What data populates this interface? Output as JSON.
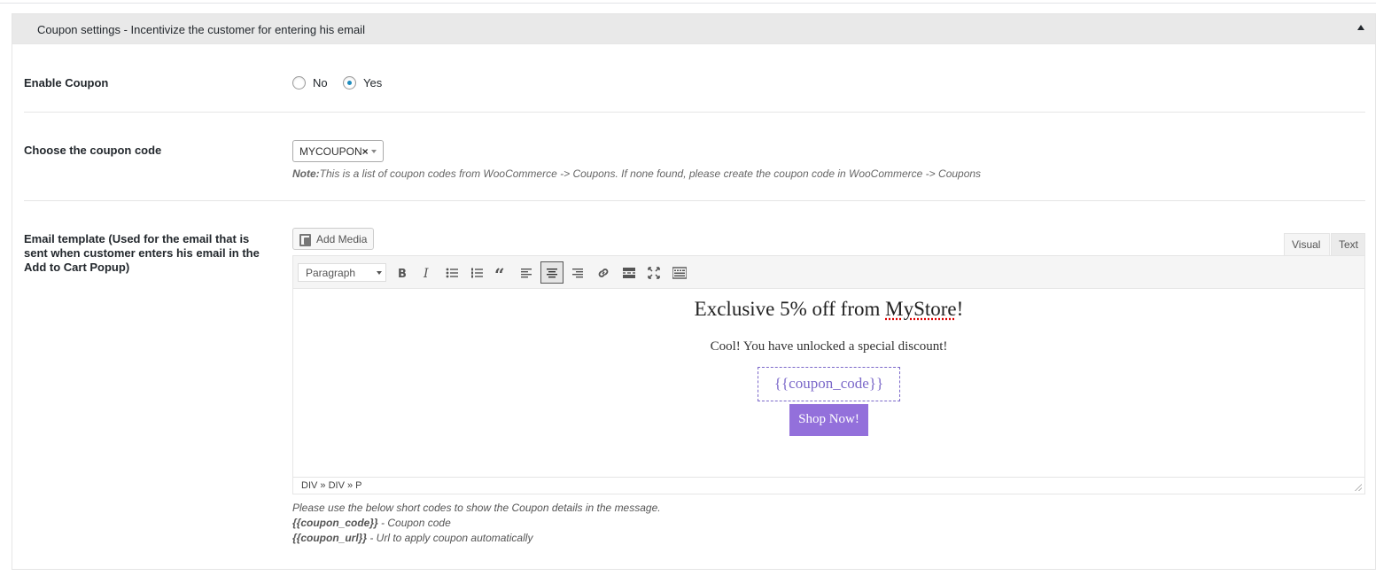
{
  "section": {
    "title": "Coupon settings - Incentivize the customer for entering his email"
  },
  "enable_coupon": {
    "label": "Enable Coupon",
    "options": [
      "No",
      "Yes"
    ],
    "selected": "Yes"
  },
  "coupon_code": {
    "label": "Choose the coupon code",
    "selected_value": "MYCOUPON",
    "clear_glyph": "×",
    "note_prefix": "Note:",
    "note_text": "This is a list of coupon codes from WooCommerce -> Coupons. If none found, please create the coupon code in WooCommerce -> Coupons"
  },
  "email_template": {
    "label": "Email template (Used for the email that is sent when customer enters his email in the Add to Cart Popup)",
    "add_media_label": "Add Media",
    "tabs": {
      "visual": "Visual",
      "text": "Text",
      "active": "Visual"
    },
    "toolbar": {
      "format": "Paragraph",
      "buttons": [
        "bold-icon",
        "italic-icon",
        "bullet-list-icon",
        "numbered-list-icon",
        "blockquote-icon",
        "align-left-icon",
        "align-center-icon",
        "align-right-icon",
        "link-icon",
        "read-more-icon",
        "fullscreen-icon",
        "toolbar-toggle-icon"
      ],
      "active_button": "align-center-icon"
    },
    "content": {
      "title_before": "Exclusive 5% off from ",
      "title_misspelled": "MyStore",
      "title_after": "!",
      "subtitle": "Cool! You have unlocked a special discount!",
      "coupon_placeholder": "{{coupon_code}}",
      "button_label": "Shop Now!",
      "accent_color": "#9370db"
    },
    "path": "DIV » DIV » P",
    "help_intro": "Please use the below short codes to show the Coupon details in the message.",
    "shortcodes": [
      {
        "code": "{{coupon_code}}",
        "desc": " - Coupon code"
      },
      {
        "code": "{{coupon_url}}",
        "desc": " - Url to apply coupon automatically"
      }
    ]
  }
}
